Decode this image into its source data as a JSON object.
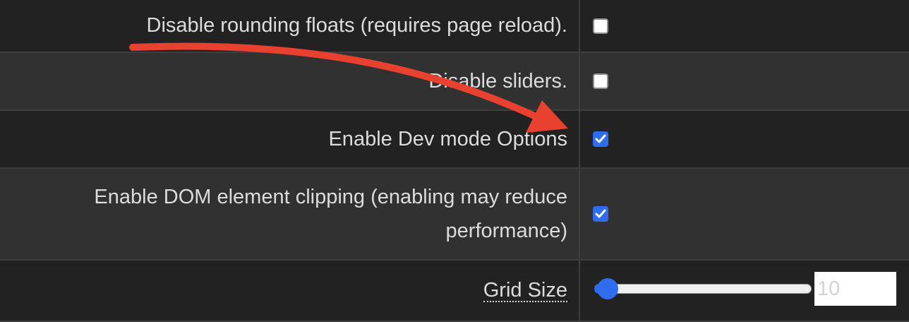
{
  "settings": [
    {
      "label": "Disable rounding floats (requires page reload).",
      "checked": false
    },
    {
      "label": "Disable sliders.",
      "checked": false
    },
    {
      "label": "Enable Dev mode Options",
      "checked": true
    },
    {
      "label_line1": "Enable DOM element clipping (enabling may reduce",
      "label_line2": "performance)",
      "checked": true
    }
  ],
  "grid_size": {
    "label": "Grid Size",
    "value": "10",
    "slider_level": 0.0
  },
  "colors": {
    "accent": "#2f6df0",
    "annotation_arrow": "#e8412f"
  }
}
